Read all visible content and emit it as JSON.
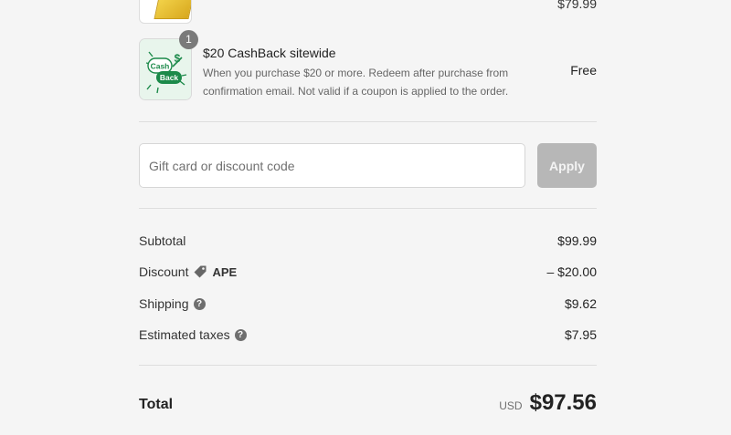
{
  "items": [
    {
      "price": "$79.99"
    },
    {
      "badge_count": "1",
      "title": "$20 CashBack sitewide",
      "description": "When you purchase $20 or more. Redeem after purchase from confirmation email. Not valid if a coupon is applied to the order.",
      "price": "Free",
      "thumb_text_1": "Cash",
      "thumb_text_2": "Back"
    }
  ],
  "discount": {
    "placeholder": "Gift card or discount code",
    "apply_label": "Apply"
  },
  "summary": {
    "subtotal_label": "Subtotal",
    "subtotal_value": "$99.99",
    "discount_label": "Discount",
    "discount_code": "APE",
    "discount_value": "– $20.00",
    "shipping_label": "Shipping",
    "shipping_value": "$9.62",
    "taxes_label": "Estimated taxes",
    "taxes_value": "$7.95",
    "help_glyph": "?"
  },
  "total": {
    "label": "Total",
    "currency": "USD",
    "amount": "$97.56"
  },
  "colors": {
    "background": "#f5f5f5",
    "apply_disabled": "#b7b7b7",
    "cashback_green": "#1c8a4a"
  }
}
